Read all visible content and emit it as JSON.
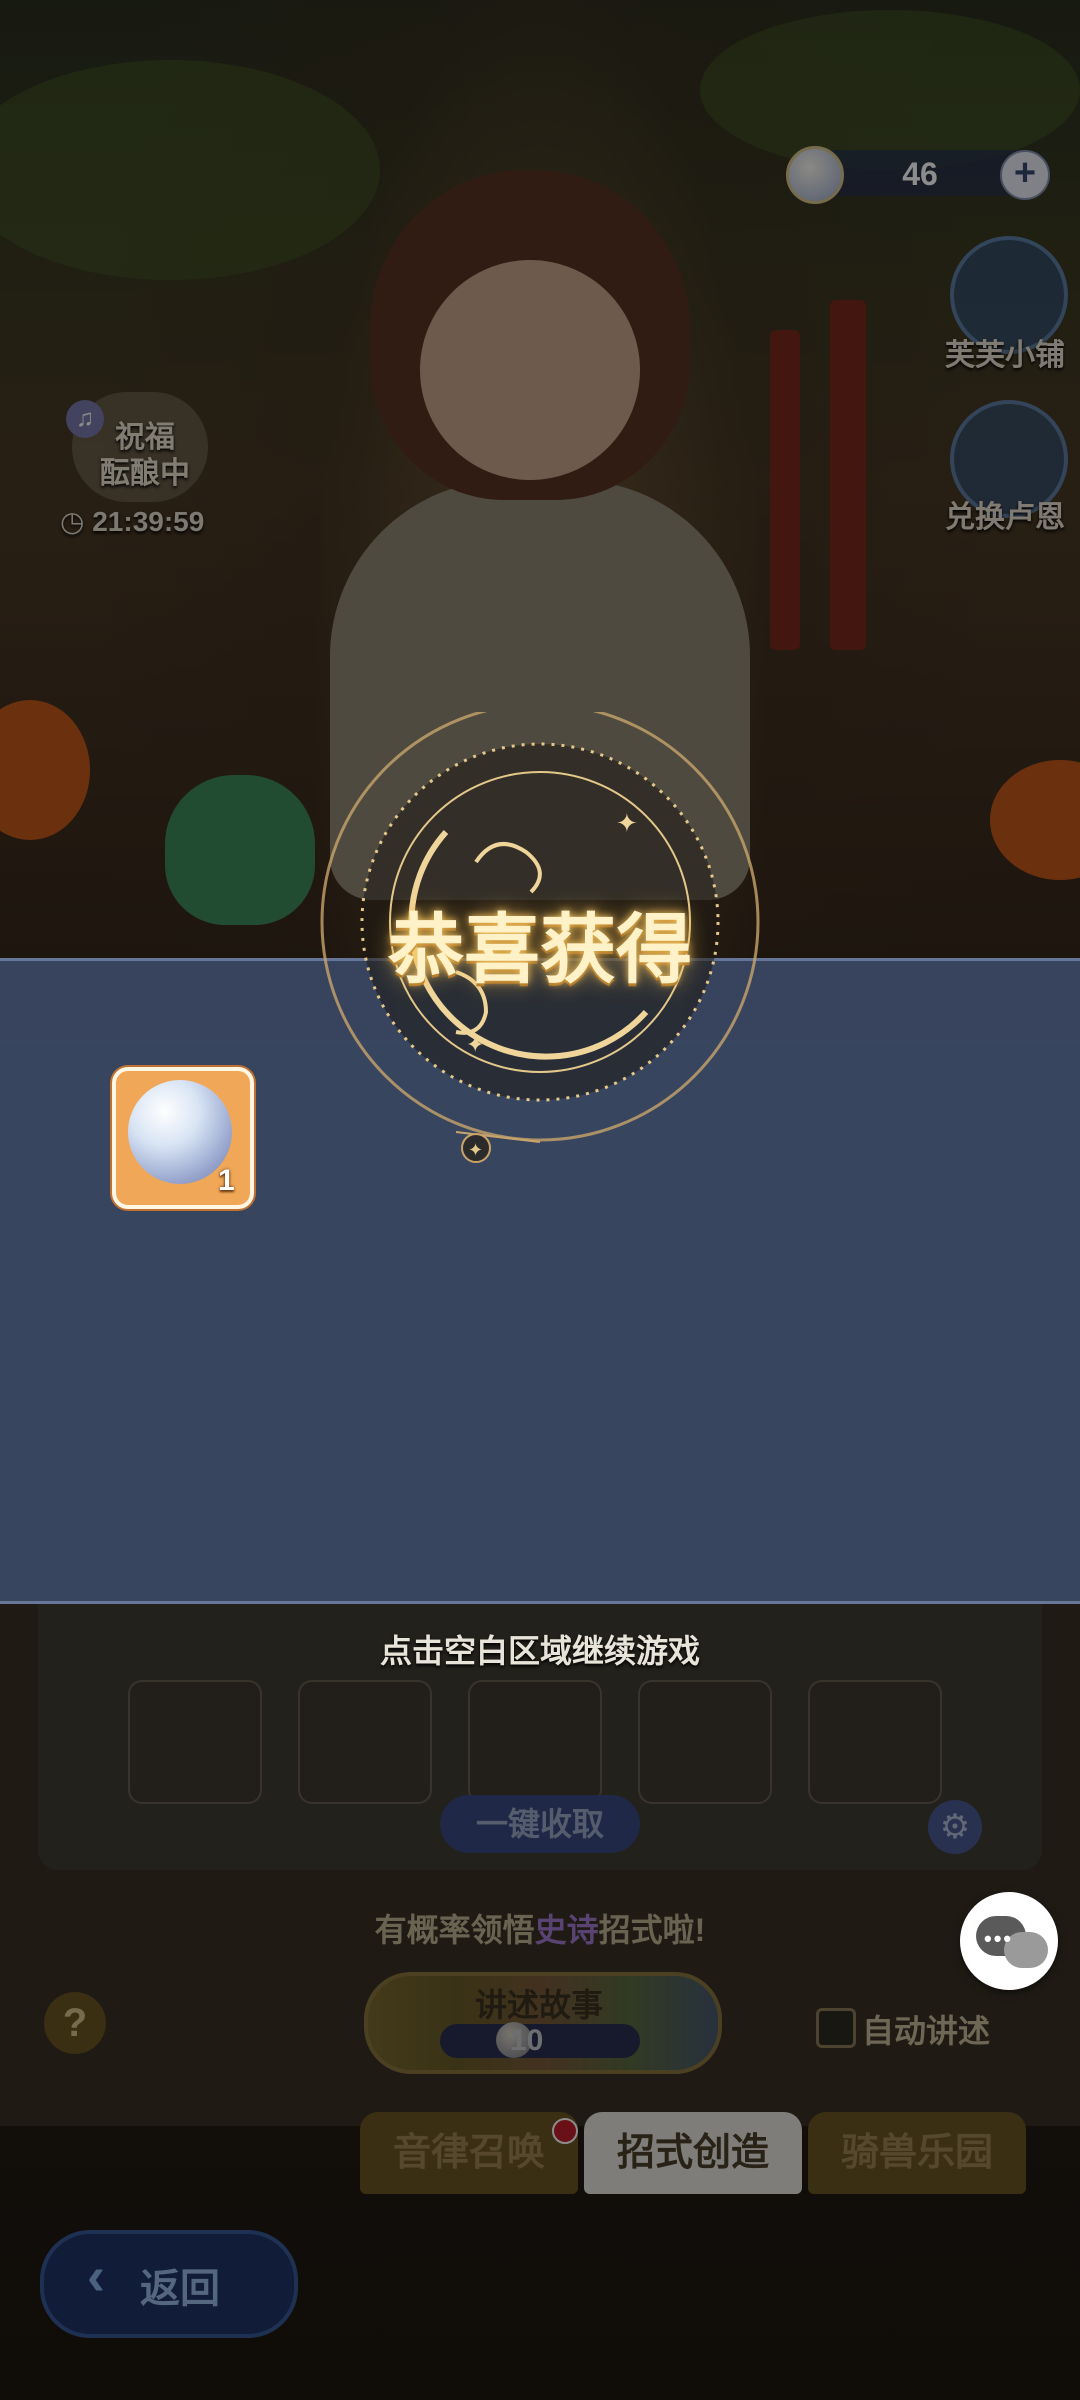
{
  "top_bar": {
    "currency_icon": "crystal-orb-icon",
    "currency_count": "46",
    "add_label": "+"
  },
  "side_menu": {
    "shop_label": "芙芙小铺",
    "exchange_label": "兑换卢恩"
  },
  "blessing": {
    "label_line1": "祝福",
    "label_line2": "酝酿中",
    "timer": "21:39:59"
  },
  "reward": {
    "title": "恭喜获得",
    "items": [
      {
        "icon": "crystal-orb-icon",
        "quantity": "1"
      }
    ],
    "continue_hint": "点击空白区域继续游戏"
  },
  "panel": {
    "collect_all_label": "一键收取",
    "hint_prefix": "有概率领悟",
    "hint_highlight": "史诗",
    "hint_suffix": "招式啦!",
    "help_label": "?",
    "story_label": "讲述故事",
    "story_cost": "10",
    "auto_story_label": "自动讲述"
  },
  "tabs": [
    {
      "label": "音律召唤",
      "active": false,
      "has_notification": true
    },
    {
      "label": "招式创造",
      "active": true,
      "has_notification": false
    },
    {
      "label": "骑兽乐园",
      "active": false,
      "has_notification": false
    }
  ],
  "back_label": "返回",
  "colors": {
    "band": "#3a4864",
    "title_gold": "#fff1c8",
    "item_frame": "#f0a858"
  }
}
